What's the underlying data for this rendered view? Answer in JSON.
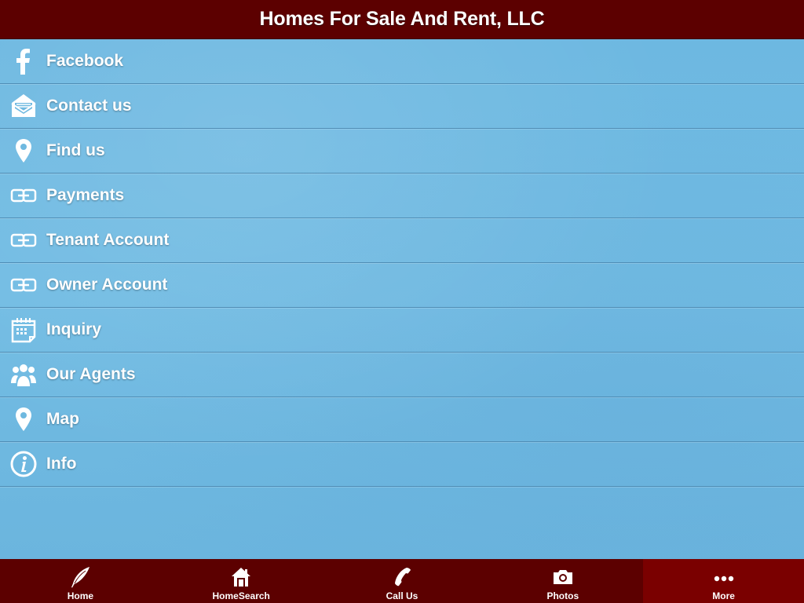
{
  "header": {
    "title": "Homes For Sale And Rent, LLC"
  },
  "menu": {
    "items": [
      {
        "label": "Facebook",
        "icon": "facebook-icon"
      },
      {
        "label": "Contact us",
        "icon": "envelope-icon"
      },
      {
        "label": "Find us",
        "icon": "map-pin-icon"
      },
      {
        "label": "Payments",
        "icon": "link-icon"
      },
      {
        "label": "Tenant Account",
        "icon": "link-icon"
      },
      {
        "label": "Owner Account",
        "icon": "link-icon"
      },
      {
        "label": "Inquiry",
        "icon": "calendar-icon"
      },
      {
        "label": "Our Agents",
        "icon": "people-icon"
      },
      {
        "label": "Map",
        "icon": "map-pin-icon"
      },
      {
        "label": "Info",
        "icon": "info-icon"
      }
    ]
  },
  "tabbar": {
    "tabs": [
      {
        "label": "Home",
        "icon": "quill-icon"
      },
      {
        "label": "HomeSearch",
        "icon": "house-icon"
      },
      {
        "label": "Call Us",
        "icon": "phone-icon"
      },
      {
        "label": "Photos",
        "icon": "camera-icon"
      },
      {
        "label": "More",
        "icon": "more-dots-icon",
        "active": true
      }
    ]
  },
  "colors": {
    "header_bg": "#5c0000",
    "content_bg": "#6fb9e0",
    "active_tab_bg": "#7a0000",
    "text": "#ffffff"
  }
}
